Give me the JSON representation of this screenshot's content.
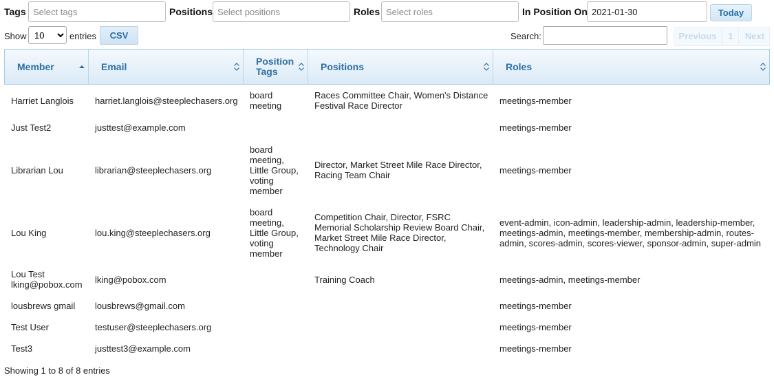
{
  "filters": {
    "tags_label": "Tags",
    "tags_placeholder": "Select tags",
    "positions_label": "Positions",
    "positions_placeholder": "Select positions",
    "roles_label": "Roles",
    "roles_placeholder": "Select roles",
    "in_position_label": "In Position On",
    "in_position_value": "2021-01-30",
    "today_label": "Today"
  },
  "controls": {
    "show_label": "Show",
    "entries_value": "10",
    "entries_label": "entries",
    "csv_label": "CSV",
    "search_label": "Search:",
    "search_value": "",
    "previous_label": "Previous",
    "page_label": "1",
    "next_label": "Next"
  },
  "table": {
    "headers": {
      "member": "Member",
      "email": "Email",
      "position_tags_1": "Position",
      "position_tags_2": "Tags",
      "positions": "Positions",
      "roles": "Roles"
    },
    "rows": [
      {
        "member": [
          "Harriet Langlois"
        ],
        "email": "harriet.langlois@steeplechasers.org",
        "tags": [
          "board",
          "meeting"
        ],
        "positions": [
          "Races Committee Chair, Women's Distance",
          "Festival Race Director"
        ],
        "roles": [
          "meetings-member"
        ]
      },
      {
        "member": [
          "Just Test2"
        ],
        "email": "justtest@example.com",
        "tags": [],
        "positions": [],
        "roles": [
          "meetings-member"
        ]
      },
      {
        "member": [
          "Librarian Lou"
        ],
        "email": "librarian@steeplechasers.org",
        "tags": [
          "board",
          "meeting,",
          "Little Group,",
          "voting",
          "member"
        ],
        "positions": [
          "Director, Market Street Mile Race Director,",
          "Racing Team Chair"
        ],
        "roles": [
          "meetings-member"
        ]
      },
      {
        "member": [
          "Lou King"
        ],
        "email": "lou.king@steeplechasers.org",
        "tags": [
          "board",
          "meeting,",
          "Little Group,",
          "voting",
          "member"
        ],
        "positions": [
          "Competition Chair, Director, FSRC",
          "Memorial Scholarship Review Board Chair,",
          "Market Street Mile Race Director,",
          "Technology Chair"
        ],
        "roles": [
          "event-admin, icon-admin, leadership-admin, leadership-member,",
          "meetings-admin, meetings-member, membership-admin, routes-",
          "admin, scores-admin, scores-viewer, sponsor-admin, super-admin"
        ]
      },
      {
        "member": [
          "Lou Test",
          "lking@pobox.com"
        ],
        "email": "lking@pobox.com",
        "tags": [],
        "positions": [
          "Training Coach"
        ],
        "roles": [
          "meetings-admin, meetings-member"
        ]
      },
      {
        "member": [
          "lousbrews gmail"
        ],
        "email": "lousbrews@gmail.com",
        "tags": [],
        "positions": [],
        "roles": [
          "meetings-member"
        ]
      },
      {
        "member": [
          "Test User"
        ],
        "email": "testuser@steeplechasers.org",
        "tags": [],
        "positions": [],
        "roles": [
          "meetings-member"
        ]
      },
      {
        "member": [
          "Test3"
        ],
        "email": "justtest3@example.com",
        "tags": [],
        "positions": [],
        "roles": [
          "meetings-member"
        ]
      }
    ]
  },
  "footer": {
    "info": "Showing 1 to 8 of 8 entries"
  },
  "colors": {
    "header_text": "#2d6fa3",
    "header_border": "#a6cbe6",
    "button_text": "#2a6fa8",
    "disabled_pager": "#c5d9ea"
  },
  "icons": {
    "sort_asc": "sort-ascending-icon",
    "sort_both": "sort-both-icon"
  }
}
